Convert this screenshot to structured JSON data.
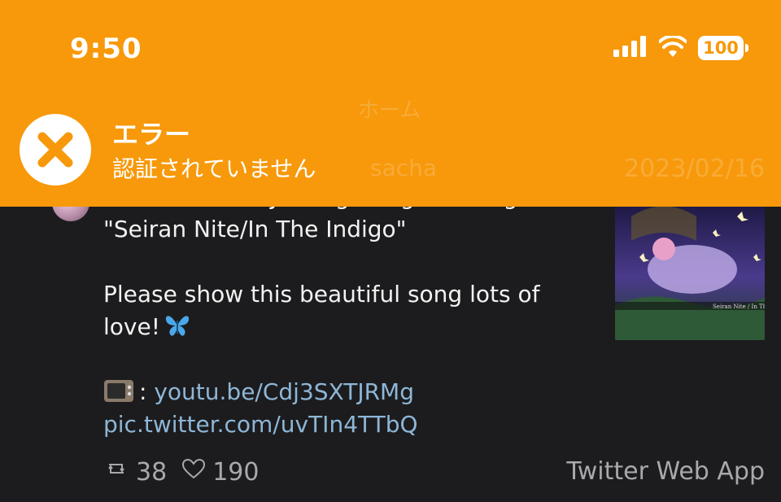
{
  "status_bar": {
    "time": "9:50",
    "battery": "100",
    "icons": [
      "signal-icon",
      "wifi-icon",
      "battery-icon"
    ]
  },
  "banner": {
    "color": "#f7990b",
    "title": "エラー",
    "message": "認証されていません",
    "icon": "error-x-icon"
  },
  "nav": {
    "title": "ホーム"
  },
  "tweet": {
    "username": "sacha",
    "date": "2023/02/16",
    "text_line1": "Illustration for JunbugP original song",
    "text_line2": "\"Seiran Nite/In The Indigo\"",
    "text_line3": "Please show this beautiful song lots of",
    "text_line4": "love!",
    "link_prefix": ":",
    "link_youtube": "youtu.be/Cdj3SXTJRMg",
    "link_pic": "pic.twitter.com/uvTIn4TTbQ",
    "retweets": "38",
    "likes": "190",
    "source": "Twitter Web App",
    "thumbnail_caption": "Seiran Nite / In The Indigo"
  }
}
